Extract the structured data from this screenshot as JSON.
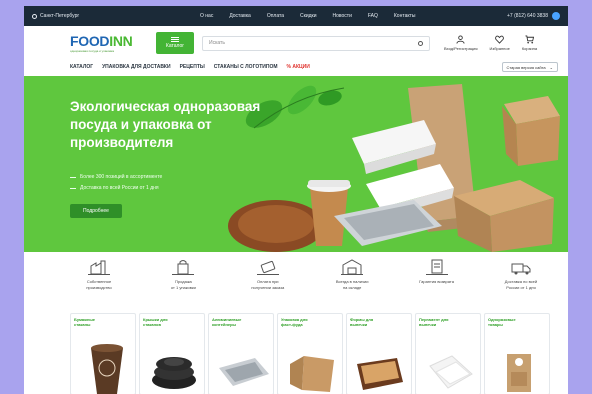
{
  "topbar": {
    "city": "Санкт-Петербург",
    "links": [
      "О нас",
      "Доставка",
      "Оплата",
      "Скидки",
      "Новости",
      "FAQ",
      "Контакты"
    ],
    "phone": "+7 (812) 640 3838"
  },
  "header": {
    "logo_food": "FOOD",
    "logo_inn": "INN",
    "logo_tagline": "одноразовая посуда и упаковка",
    "catalog_label": "Каталог",
    "search_placeholder": "Искать",
    "icons": [
      {
        "name": "user-icon",
        "label": "Вход/Регистрация"
      },
      {
        "name": "heart-icon",
        "label": "Избранное"
      },
      {
        "name": "cart-icon",
        "label": "Корзина"
      }
    ]
  },
  "nav": {
    "items": [
      "КАТАЛОГ",
      "УПАКОВКА ДЛЯ ДОСТАВКИ",
      "РЕЦЕПТЫ",
      "СТАКАНЫ С ЛОГОТИПОМ"
    ],
    "sale": "% АКЦИИ",
    "site_select": "Старая версия сайта"
  },
  "hero": {
    "title": "Экологическая одноразовая посуда и упаковка от производителя",
    "bullets": [
      "Более 300 позиций в ассортименте",
      "Доставка по всей России от 1 дня"
    ],
    "button": "Подробнее"
  },
  "features": [
    {
      "icon": "factory-icon",
      "line1": "Собственное",
      "line2": "производство"
    },
    {
      "icon": "bag-icon",
      "line1": "Продажа",
      "line2": "от 1 упаковки"
    },
    {
      "icon": "card-icon",
      "line1": "Оплата при",
      "line2": "получении заказа"
    },
    {
      "icon": "warehouse-icon",
      "line1": "Всегда в наличии",
      "line2": "на складе"
    },
    {
      "icon": "certificate-icon",
      "line1": "Гарантия возврата",
      "line2": ""
    },
    {
      "icon": "truck-icon",
      "line1": "Доставка по всей",
      "line2": "России от 1 дня"
    }
  ],
  "cards": [
    {
      "l1": "Бумажные",
      "l2": "стаканы"
    },
    {
      "l1": "Крышки для",
      "l2": "стаканов"
    },
    {
      "l1": "Алюминиевые",
      "l2": "контейнеры"
    },
    {
      "l1": "Упаковка для",
      "l2": "фаст-фуда"
    },
    {
      "l1": "Формы для",
      "l2": "выпечки"
    },
    {
      "l1": "Пергамент для",
      "l2": "выпечки"
    },
    {
      "l1": "Одноразовые",
      "l2": "товары"
    }
  ],
  "colors": {
    "accent_green": "#43b435",
    "topbar": "#1b2a38",
    "hero": "#5fc73e",
    "sale": "#e0332e"
  }
}
